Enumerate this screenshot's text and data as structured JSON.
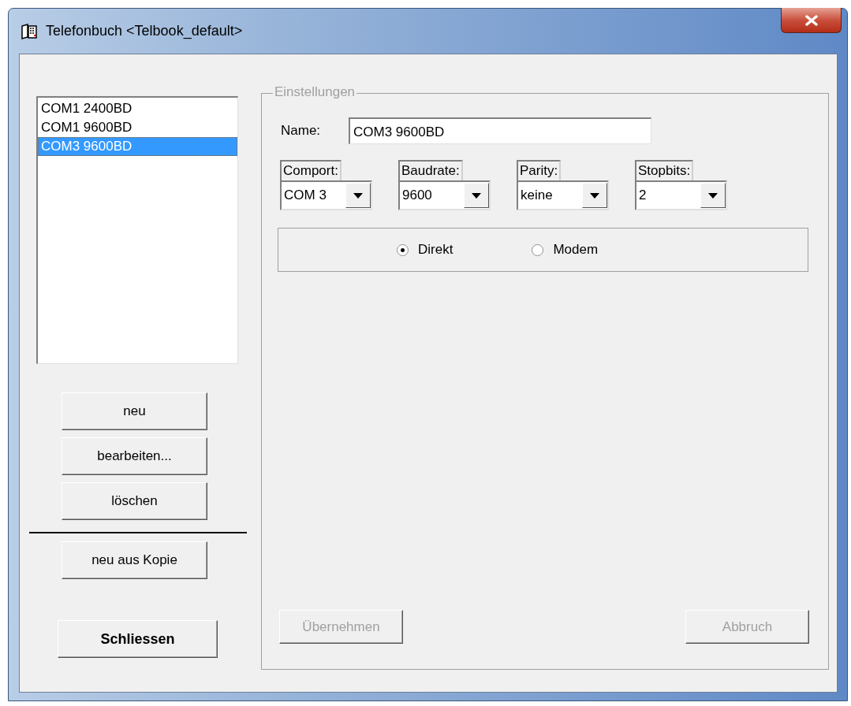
{
  "window": {
    "title": "Telefonbuch  <Telbook_default>"
  },
  "list": {
    "items": [
      {
        "label": "COM1 2400BD",
        "selected": false
      },
      {
        "label": "COM1 9600BD",
        "selected": false
      },
      {
        "label": "COM3 9600BD",
        "selected": true
      }
    ]
  },
  "buttons": [
    {
      "label": "neu"
    },
    {
      "label": "bearbeiten..."
    },
    {
      "label": "löschen"
    }
  ],
  "copy_button": {
    "label": "neu aus Kopie"
  },
  "close_button": {
    "label": "Schliessen"
  },
  "settings": {
    "title": "Einstellungen",
    "name_label": "Name:",
    "name_value": "COM3 9600BD",
    "combos": [
      {
        "label": "Comport:",
        "value": "COM 3"
      },
      {
        "label": "Baudrate:",
        "value": "9600"
      },
      {
        "label": "Parity:",
        "value": "keine"
      },
      {
        "label": "Stopbits:",
        "value": "2"
      }
    ],
    "connection": [
      {
        "label": "Direkt",
        "selected": true
      },
      {
        "label": "Modem",
        "selected": false
      }
    ],
    "apply_button": {
      "label": "Übernehmen",
      "disabled": true
    },
    "cancel_button": {
      "label": "Abbruch",
      "disabled": true
    }
  }
}
